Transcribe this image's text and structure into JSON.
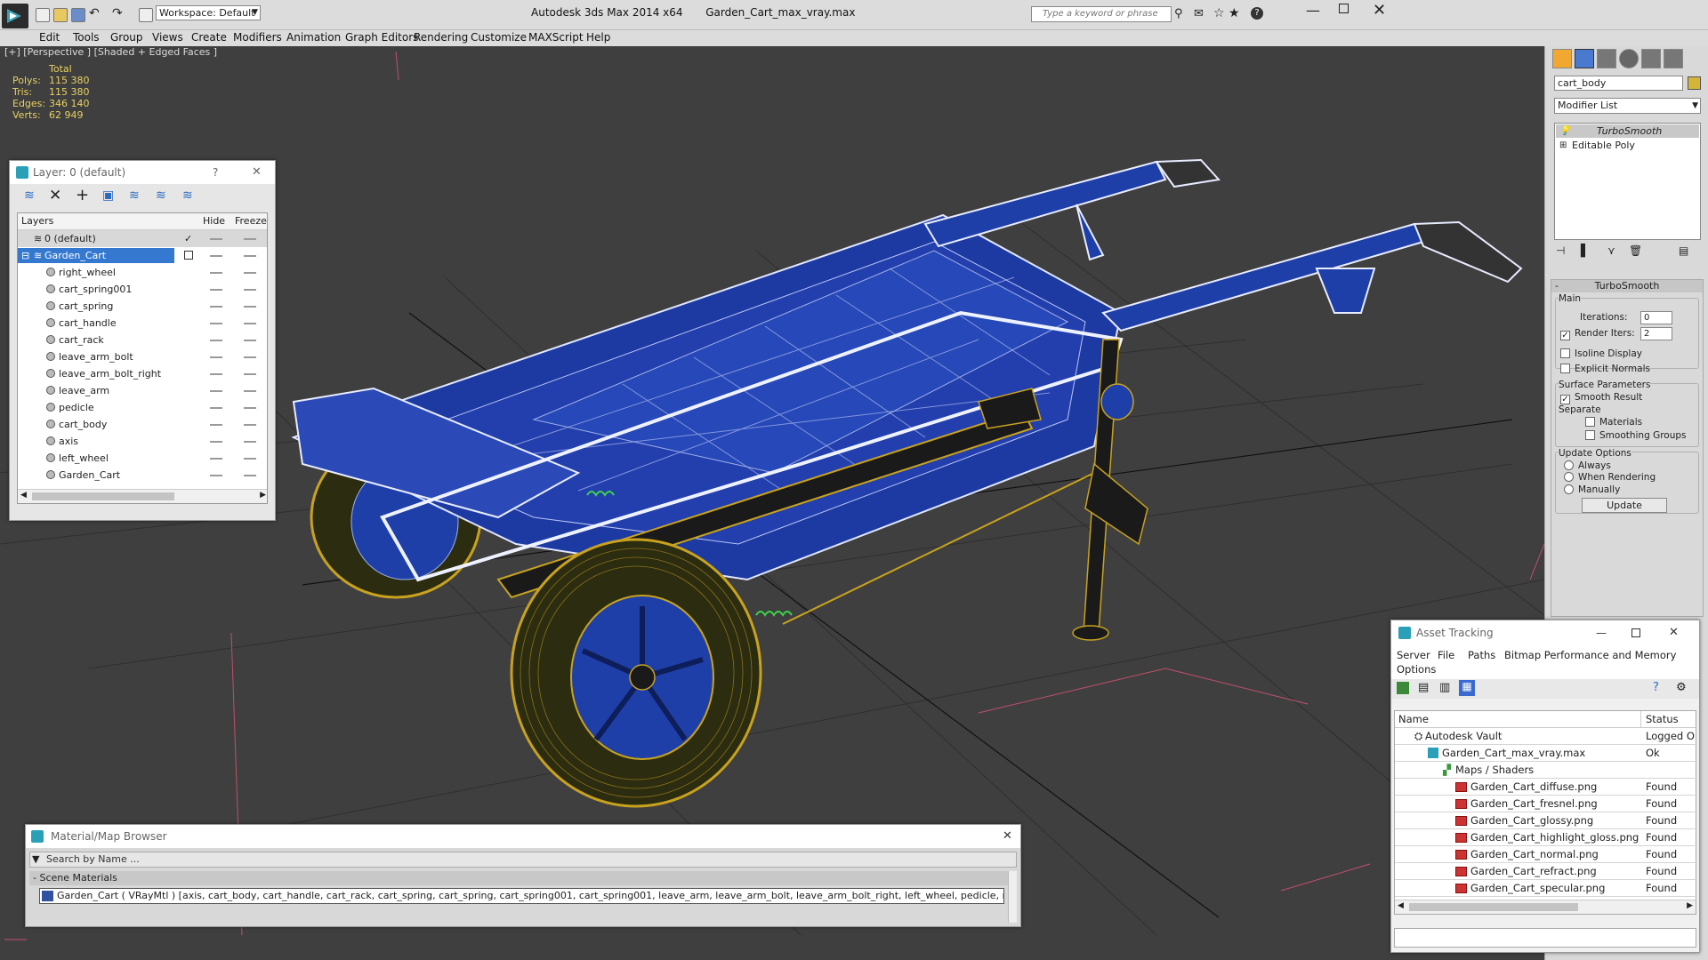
{
  "app": {
    "title": "Autodesk 3ds Max  2014 x64",
    "file": "Garden_Cart_max_vray.max",
    "workspace": "Workspace: Default",
    "search_placeholder": "Type a keyword or phrase"
  },
  "menu": [
    "Edit",
    "Tools",
    "Group",
    "Views",
    "Create",
    "Modifiers",
    "Animation",
    "Graph Editors",
    "Rendering",
    "Customize",
    "MAXScript",
    "Help"
  ],
  "viewport": {
    "label": "[+] [Perspective ] [Shaded + Edged Faces ]",
    "stats": {
      "header": "Total",
      "rows": [
        {
          "label": "Polys:",
          "value": "115 380"
        },
        {
          "label": "Tris:",
          "value": "115 380"
        },
        {
          "label": "Edges:",
          "value": "346 140"
        },
        {
          "label": "Verts:",
          "value": "62 949"
        }
      ]
    }
  },
  "layer_panel": {
    "title": "Layer: 0 (default)",
    "help": "?",
    "col_layers": "Layers",
    "col_hide": "Hide",
    "col_freeze": "Freeze",
    "rows": [
      {
        "name": "0 (default)",
        "level": 1
      },
      {
        "name": "Garden_Cart",
        "level": 1,
        "selected": true
      },
      {
        "name": "right_wheel",
        "level": 2
      },
      {
        "name": "cart_spring001",
        "level": 2
      },
      {
        "name": "cart_spring",
        "level": 2
      },
      {
        "name": "cart_handle",
        "level": 2
      },
      {
        "name": "cart_rack",
        "level": 2
      },
      {
        "name": "leave_arm_bolt",
        "level": 2
      },
      {
        "name": "leave_arm_bolt_right",
        "level": 2
      },
      {
        "name": "leave_arm",
        "level": 2
      },
      {
        "name": "pedicle",
        "level": 2
      },
      {
        "name": "cart_body",
        "level": 2
      },
      {
        "name": "axis",
        "level": 2
      },
      {
        "name": "left_wheel",
        "level": 2
      },
      {
        "name": "Garden_Cart",
        "level": 2
      }
    ]
  },
  "command_panel": {
    "object_name": "cart_body",
    "modifier_list": "Modifier List",
    "stack": [
      "TurboSmooth",
      "Editable Poly"
    ],
    "rollout_title": "TurboSmooth",
    "main": "Main",
    "iterations_label": "Iterations:",
    "iterations_value": "0",
    "render_iters_label": "Render Iters:",
    "render_iters_value": "2",
    "isoline": "Isoline Display",
    "explicit_normals": "Explicit Normals",
    "surface_params": "Surface Parameters",
    "smooth_result": "Smooth Result",
    "separate": "Separate",
    "materials": "Materials",
    "smoothing_groups": "Smoothing Groups",
    "update_options": "Update Options",
    "always": "Always",
    "when_rendering": "When Rendering",
    "manually": "Manually",
    "update_button": "Update"
  },
  "asset_tracking": {
    "title": "Asset Tracking",
    "menu": [
      "Server",
      "File",
      "Paths",
      "Bitmap Performance and Memory",
      "Options"
    ],
    "col_name": "Name",
    "col_status": "Status",
    "rows": [
      {
        "name": "Autodesk Vault",
        "status": "Logged O",
        "indent": 1
      },
      {
        "name": "Garden_Cart_max_vray.max",
        "status": "Ok",
        "indent": 2
      },
      {
        "name": "Maps / Shaders",
        "status": "",
        "indent": 3
      },
      {
        "name": "Garden_Cart_diffuse.png",
        "status": "Found",
        "indent": 4
      },
      {
        "name": "Garden_Cart_fresnel.png",
        "status": "Found",
        "indent": 4
      },
      {
        "name": "Garden_Cart_glossy.png",
        "status": "Found",
        "indent": 4
      },
      {
        "name": "Garden_Cart_highlight_gloss.png",
        "status": "Found",
        "indent": 4
      },
      {
        "name": "Garden_Cart_normal.png",
        "status": "Found",
        "indent": 4
      },
      {
        "name": "Garden_Cart_refract.png",
        "status": "Found",
        "indent": 4
      },
      {
        "name": "Garden_Cart_specular.png",
        "status": "Found",
        "indent": 4
      }
    ]
  },
  "material_browser": {
    "title": "Material/Map Browser",
    "search_placeholder": "Search by Name ...",
    "section": "- Scene Materials",
    "entry": "Garden_Cart  ( VRayMtl ) [axis, cart_body, cart_handle, cart_rack, cart_spring, cart_spring, cart_spring001, cart_spring001, leave_arm, leave_arm_bolt, leave_arm_bolt_right, left_wheel, pedicle, right_wheel]"
  },
  "colors": {
    "cart_blue": "#1f3fa8",
    "wire_yellow": "#c8a21e",
    "stat_yellow": "#e8d060",
    "selection_blue": "#3478d0"
  }
}
